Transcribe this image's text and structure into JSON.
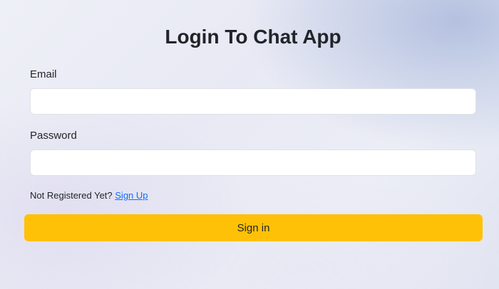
{
  "page": {
    "title": "Login To Chat App"
  },
  "form": {
    "email_label": "Email",
    "email_value": "",
    "password_label": "Password",
    "password_value": "",
    "register_prompt": "Not Registered Yet?",
    "signup_link": "Sign Up",
    "submit_label": "Sign in"
  },
  "colors": {
    "submit_button": "#ffc107",
    "link": "#0d6efd"
  }
}
